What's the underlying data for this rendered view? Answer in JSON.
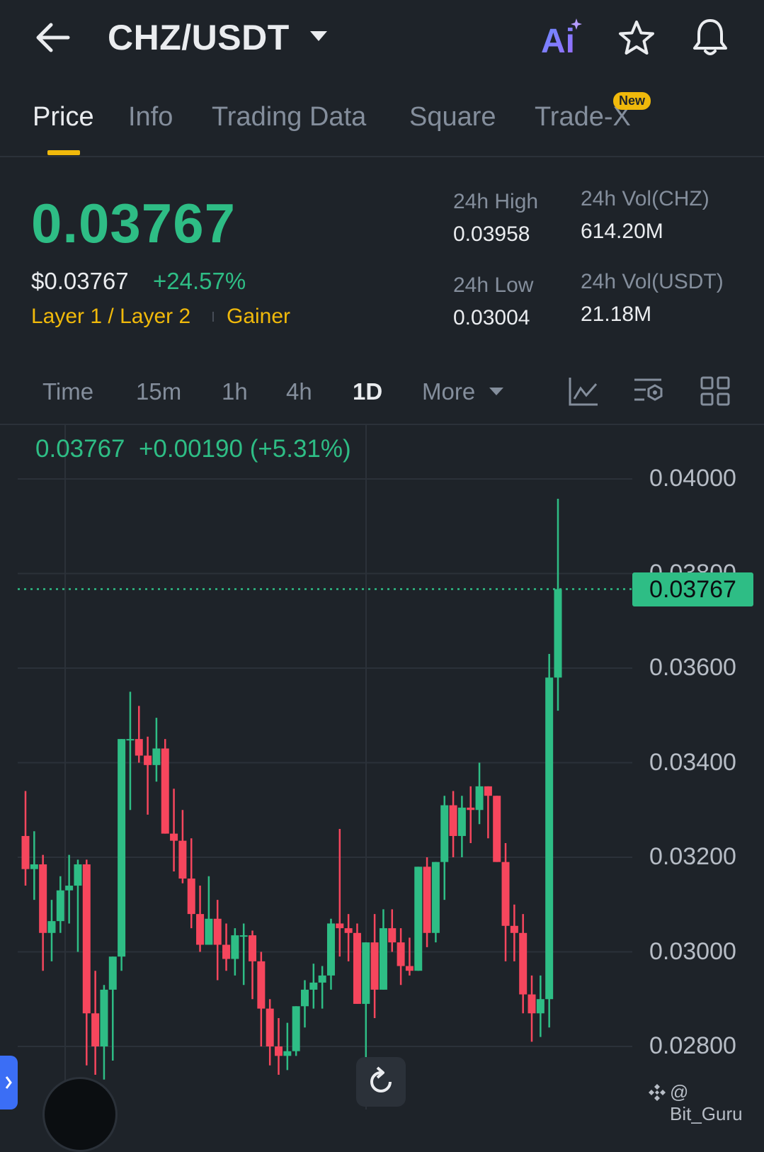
{
  "header": {
    "pair": "CHZ/USDT",
    "ai_label": "Ai"
  },
  "tabs": [
    {
      "label": "Price",
      "active": true
    },
    {
      "label": "Info"
    },
    {
      "label": "Trading Data"
    },
    {
      "label": "Square"
    },
    {
      "label": "Trade-X",
      "badge": "New"
    }
  ],
  "ticker": {
    "last_price": "0.03767",
    "usd_price": "$0.03767",
    "change_pct": "+24.57%",
    "tag1": "Layer 1 / Layer 2",
    "tag2": "Gainer",
    "high_label": "24h High",
    "high_value": "0.03958",
    "low_label": "24h Low",
    "low_value": "0.03004",
    "vol_chz_label": "24h Vol(CHZ)",
    "vol_chz_value": "614.20M",
    "vol_usdt_label": "24h Vol(USDT)",
    "vol_usdt_value": "21.18M"
  },
  "timeframes": [
    {
      "label": "Time"
    },
    {
      "label": "15m"
    },
    {
      "label": "1h"
    },
    {
      "label": "4h"
    },
    {
      "label": "1D",
      "active": true
    },
    {
      "label": "More"
    }
  ],
  "chart_header": {
    "price": "0.03767",
    "change": "+0.00190",
    "change_pct": "(+5.31%)"
  },
  "watermark": "@ Bit_Guru",
  "colors": {
    "up": "#2ebd85",
    "down": "#f6465d",
    "accent": "#f0b90b",
    "bg": "#1e2329"
  },
  "chart_data": {
    "type": "candlestick",
    "y_ticks": [
      "0.04000",
      "0.03800",
      "0.03600",
      "0.03400",
      "0.03200",
      "0.03000",
      "0.02800"
    ],
    "ylim": [
      0.0272,
      0.041
    ],
    "current_price": "0.03767",
    "candles": [
      {
        "o": 0.03245,
        "h": 0.0334,
        "l": 0.0314,
        "c": 0.03175
      },
      {
        "o": 0.03175,
        "h": 0.03255,
        "l": 0.0311,
        "c": 0.03185
      },
      {
        "o": 0.03185,
        "h": 0.03205,
        "l": 0.0296,
        "c": 0.0304
      },
      {
        "o": 0.0304,
        "h": 0.0311,
        "l": 0.0298,
        "c": 0.03065
      },
      {
        "o": 0.03065,
        "h": 0.0316,
        "l": 0.0304,
        "c": 0.0313
      },
      {
        "o": 0.0313,
        "h": 0.03205,
        "l": 0.0306,
        "c": 0.0314
      },
      {
        "o": 0.0314,
        "h": 0.03195,
        "l": 0.03,
        "c": 0.03185
      },
      {
        "o": 0.03185,
        "h": 0.03195,
        "l": 0.0276,
        "c": 0.0287
      },
      {
        "o": 0.0287,
        "h": 0.0296,
        "l": 0.0274,
        "c": 0.028
      },
      {
        "o": 0.028,
        "h": 0.0293,
        "l": 0.0273,
        "c": 0.0292
      },
      {
        "o": 0.0292,
        "h": 0.0298,
        "l": 0.0277,
        "c": 0.0299
      },
      {
        "o": 0.0299,
        "h": 0.03255,
        "l": 0.0296,
        "c": 0.0345
      },
      {
        "o": 0.0345,
        "h": 0.0355,
        "l": 0.033,
        "c": 0.0345
      },
      {
        "o": 0.0345,
        "h": 0.0352,
        "l": 0.034,
        "c": 0.03415
      },
      {
        "o": 0.03415,
        "h": 0.03455,
        "l": 0.0329,
        "c": 0.03395
      },
      {
        "o": 0.03395,
        "h": 0.03495,
        "l": 0.0336,
        "c": 0.0343
      },
      {
        "o": 0.0343,
        "h": 0.0345,
        "l": 0.0325,
        "c": 0.0325
      },
      {
        "o": 0.0325,
        "h": 0.03345,
        "l": 0.0317,
        "c": 0.03235
      },
      {
        "o": 0.03235,
        "h": 0.033,
        "l": 0.03145,
        "c": 0.03155
      },
      {
        "o": 0.03155,
        "h": 0.0324,
        "l": 0.0305,
        "c": 0.0308
      },
      {
        "o": 0.0308,
        "h": 0.0314,
        "l": 0.03,
        "c": 0.03015
      },
      {
        "o": 0.03015,
        "h": 0.0316,
        "l": 0.0303,
        "c": 0.0307
      },
      {
        "o": 0.0307,
        "h": 0.0311,
        "l": 0.0294,
        "c": 0.03015
      },
      {
        "o": 0.03015,
        "h": 0.0306,
        "l": 0.0296,
        "c": 0.02985
      },
      {
        "o": 0.02985,
        "h": 0.0305,
        "l": 0.0295,
        "c": 0.03035
      },
      {
        "o": 0.03035,
        "h": 0.0306,
        "l": 0.0293,
        "c": 0.03035
      },
      {
        "o": 0.03035,
        "h": 0.03045,
        "l": 0.029,
        "c": 0.0298
      },
      {
        "o": 0.0298,
        "h": 0.03,
        "l": 0.028,
        "c": 0.0288
      },
      {
        "o": 0.0288,
        "h": 0.029,
        "l": 0.0276,
        "c": 0.028
      },
      {
        "o": 0.028,
        "h": 0.0286,
        "l": 0.0274,
        "c": 0.0278
      },
      {
        "o": 0.0278,
        "h": 0.0285,
        "l": 0.0275,
        "c": 0.0279
      },
      {
        "o": 0.0279,
        "h": 0.02875,
        "l": 0.0278,
        "c": 0.02885
      },
      {
        "o": 0.02885,
        "h": 0.0294,
        "l": 0.0284,
        "c": 0.0292
      },
      {
        "o": 0.0292,
        "h": 0.02975,
        "l": 0.0288,
        "c": 0.02935
      },
      {
        "o": 0.02935,
        "h": 0.0297,
        "l": 0.0288,
        "c": 0.0295
      },
      {
        "o": 0.0295,
        "h": 0.0307,
        "l": 0.0292,
        "c": 0.0306
      },
      {
        "o": 0.0306,
        "h": 0.0326,
        "l": 0.0299,
        "c": 0.0305
      },
      {
        "o": 0.0305,
        "h": 0.0308,
        "l": 0.0298,
        "c": 0.0304
      },
      {
        "o": 0.0304,
        "h": 0.0306,
        "l": 0.0292,
        "c": 0.0289
      },
      {
        "o": 0.0289,
        "h": 0.0301,
        "l": 0.0276,
        "c": 0.0302
      },
      {
        "o": 0.0302,
        "h": 0.0308,
        "l": 0.0286,
        "c": 0.0292
      },
      {
        "o": 0.0292,
        "h": 0.0309,
        "l": 0.0294,
        "c": 0.0305
      },
      {
        "o": 0.0305,
        "h": 0.0309,
        "l": 0.03,
        "c": 0.0302
      },
      {
        "o": 0.0302,
        "h": 0.0305,
        "l": 0.0293,
        "c": 0.0297
      },
      {
        "o": 0.0297,
        "h": 0.0303,
        "l": 0.0295,
        "c": 0.0296
      },
      {
        "o": 0.0296,
        "h": 0.0318,
        "l": 0.0297,
        "c": 0.0318
      },
      {
        "o": 0.0318,
        "h": 0.032,
        "l": 0.0301,
        "c": 0.0304
      },
      {
        "o": 0.0304,
        "h": 0.0319,
        "l": 0.0302,
        "c": 0.0319
      },
      {
        "o": 0.0319,
        "h": 0.0333,
        "l": 0.0311,
        "c": 0.0331
      },
      {
        "o": 0.0331,
        "h": 0.0334,
        "l": 0.032,
        "c": 0.03245
      },
      {
        "o": 0.03245,
        "h": 0.0333,
        "l": 0.032,
        "c": 0.03305
      },
      {
        "o": 0.03305,
        "h": 0.0335,
        "l": 0.0323,
        "c": 0.033
      },
      {
        "o": 0.033,
        "h": 0.034,
        "l": 0.0327,
        "c": 0.0335
      },
      {
        "o": 0.0335,
        "h": 0.0334,
        "l": 0.0324,
        "c": 0.0333
      },
      {
        "o": 0.0333,
        "h": 0.0333,
        "l": 0.032,
        "c": 0.0319
      },
      {
        "o": 0.0319,
        "h": 0.0323,
        "l": 0.0298,
        "c": 0.03055
      },
      {
        "o": 0.03055,
        "h": 0.031,
        "l": 0.0298,
        "c": 0.0304
      },
      {
        "o": 0.0304,
        "h": 0.0308,
        "l": 0.0287,
        "c": 0.0291
      },
      {
        "o": 0.0291,
        "h": 0.0295,
        "l": 0.0281,
        "c": 0.0287
      },
      {
        "o": 0.0287,
        "h": 0.0295,
        "l": 0.0282,
        "c": 0.029
      },
      {
        "o": 0.029,
        "h": 0.0363,
        "l": 0.0284,
        "c": 0.0358
      },
      {
        "o": 0.0358,
        "h": 0.03958,
        "l": 0.0351,
        "c": 0.03767
      }
    ]
  }
}
